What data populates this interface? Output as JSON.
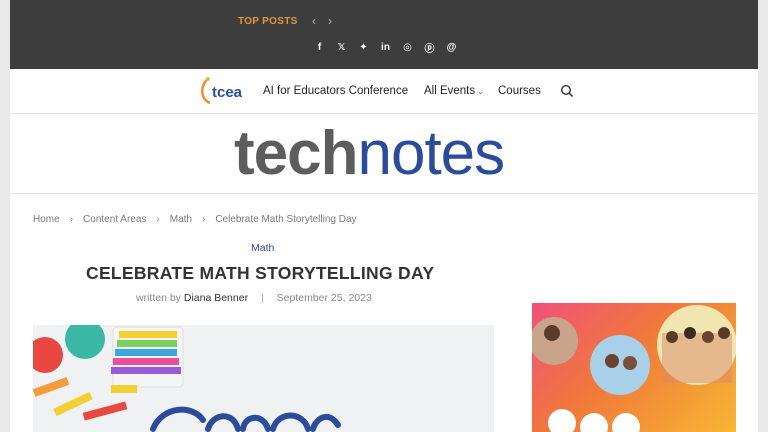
{
  "topbar": {
    "top_posts_label": "TOP POSTS",
    "prev_icon": "chevron-left-icon",
    "next_icon": "chevron-right-icon",
    "socials": [
      {
        "icon": "facebook-icon",
        "glyph": "f"
      },
      {
        "icon": "x-icon",
        "glyph": "𝕏"
      },
      {
        "icon": "bluesky-icon",
        "glyph": "✦"
      },
      {
        "icon": "linkedin-icon",
        "glyph": "in"
      },
      {
        "icon": "instagram-icon",
        "glyph": "◎"
      },
      {
        "icon": "pinterest-icon",
        "glyph": "ⓟ"
      },
      {
        "icon": "threads-icon",
        "glyph": "@"
      }
    ]
  },
  "nav": {
    "logo_text": "tcea",
    "items": [
      {
        "label": "AI for Educators Conference"
      },
      {
        "label": "All Events"
      },
      {
        "label": "Courses"
      }
    ]
  },
  "brand": {
    "tech": "tech",
    "notes": "notes"
  },
  "breadcrumb": [
    "Home",
    "Content Areas",
    "Math",
    "Celebrate Math Storytelling Day"
  ],
  "article": {
    "category": "Math",
    "title": "CELEBRATE MATH STORYTELLING DAY",
    "written_by": "written by",
    "author": "Diana Benner",
    "date": "September 25, 2023"
  },
  "colors": {
    "accent": "#2b4c9b",
    "top_posts": "#e0963b",
    "topbar_bg": "#3d3d3d"
  }
}
